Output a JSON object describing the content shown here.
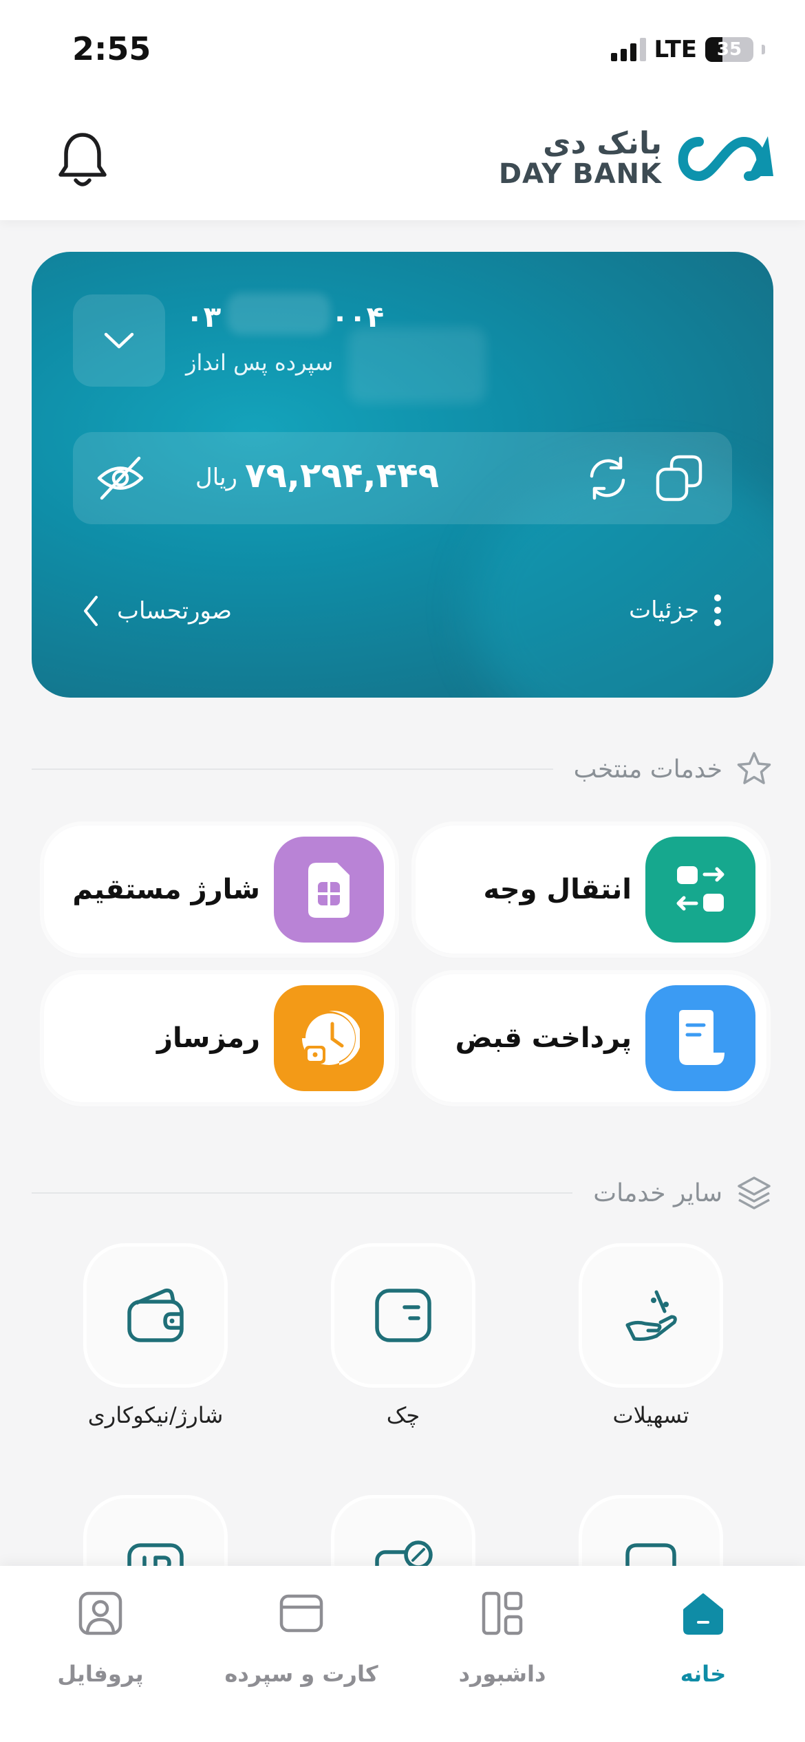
{
  "status_bar": {
    "time": "2:55",
    "network": "LTE",
    "battery": "35"
  },
  "header": {
    "logo_fa": "بانک دی",
    "logo_en_day": "DAY",
    "logo_en_bank": "BANK"
  },
  "account_card": {
    "account_number_start": "۰۳",
    "account_number_end": "۰۰۴",
    "account_type": "سپرده پس انداز",
    "balance": "۷۹,۲۹۴,۴۴۹",
    "currency": "ریال",
    "statement_label": "صورتحساب",
    "details_label": "جزئیات"
  },
  "featured": {
    "title": "خدمات منتخب",
    "items": [
      {
        "label": "انتقال وجه",
        "color": "#16a88e"
      },
      {
        "label": "شارژ مستقیم",
        "color": "#b983d6"
      },
      {
        "label": "پرداخت قبض",
        "color": "#3b9bf3"
      },
      {
        "label": "رمزساز",
        "color": "#f39a17"
      }
    ]
  },
  "other_services": {
    "title": "سایر خدمات",
    "items": [
      {
        "label": "تسهیلات",
        "icon": "loan-hand-icon"
      },
      {
        "label": "چک",
        "icon": "cheque-icon"
      },
      {
        "label": "شارژ/نیکوکاری",
        "icon": "wallet-icon"
      }
    ]
  },
  "bottom_nav": {
    "items": [
      {
        "label": "خانه",
        "icon": "home-icon",
        "active": true
      },
      {
        "label": "داشبورد",
        "icon": "dashboard-icon",
        "active": false
      },
      {
        "label": "کارت و سپرده",
        "icon": "card-icon",
        "active": false
      },
      {
        "label": "پروفایل",
        "icon": "profile-icon",
        "active": false
      }
    ]
  },
  "colors": {
    "accent": "#0f8ca6",
    "icon_teal": "#1f6f78"
  }
}
